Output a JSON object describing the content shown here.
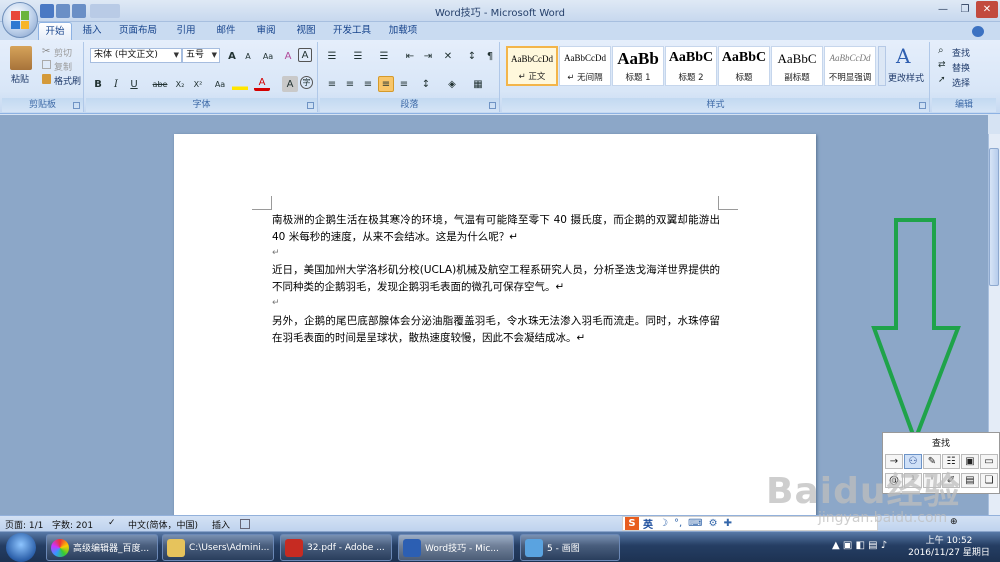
{
  "window": {
    "title": "Word技巧 - Microsoft Word",
    "title_suffix": "..."
  },
  "tabs": [
    "开始",
    "插入",
    "页面布局",
    "引用",
    "邮件",
    "审阅",
    "视图",
    "开发工具",
    "加载项"
  ],
  "clipboard": {
    "paste": "粘贴",
    "cut": "剪切",
    "copy": "复制",
    "format_painter": "格式刷",
    "group": "剪贴板"
  },
  "font": {
    "name": "宋体 (中文正文)",
    "size": "五号",
    "group": "字体",
    "bold": "B",
    "italic": "I",
    "underline": "U",
    "strike": "abe",
    "sub": "X₂",
    "sup": "X²",
    "aa": "Aa",
    "grow": "A",
    "shrink": "A",
    "clear": "A",
    "char_border": "A",
    "char_shade": "A"
  },
  "paragraph": {
    "group": "段落"
  },
  "styles": {
    "group": "样式",
    "items": [
      {
        "sample": "AaBbCcDd",
        "name": "↵ 正文"
      },
      {
        "sample": "AaBbCcDd",
        "name": "↵ 无间隔"
      },
      {
        "sample": "AaBb",
        "name": "标题 1"
      },
      {
        "sample": "AaBbC",
        "name": "标题 2"
      },
      {
        "sample": "AaBbC",
        "name": "标题"
      },
      {
        "sample": "AaBbC",
        "name": "副标题"
      },
      {
        "sample": "AaBbCcDd",
        "name": "不明显强调"
      }
    ],
    "change": "更改样式"
  },
  "editing": {
    "group": "编辑",
    "find": "查找",
    "replace": "替换",
    "select": "选择"
  },
  "document": {
    "paragraphs": [
      "南极洲的企鹅生活在极其寒冷的环境，气温有可能降至零下 40 摄氏度，而企鹅的双翼却能游出 40 米每秒的速度，从来不会结冰。这是为什么呢？↵",
      "近日，美国加州大学洛杉矶分校(UCLA)机械及航空工程系研究人员，分析圣迭戈海洋世界提供的不同种类的企鹅羽毛，发现企鹅羽毛表面的微孔可保存空气。↵",
      "另外，企鹅的尾巴底部腺体会分泌油脂覆盖羽毛，令水珠无法渗入羽毛而流走。同时，水珠停留在羽毛表面的时间是呈球状，散热速度较慢，因此不会凝结成冰。↵"
    ],
    "para_mark": "↵"
  },
  "find_panel": {
    "title": "查找"
  },
  "status": {
    "page": "页面: 1/1",
    "words": "字数: 201",
    "lang": "中文(简体，中国)",
    "insert": "插入"
  },
  "ime": {
    "lang": "英"
  },
  "taskbar": {
    "items": [
      "高级编辑器_百度...",
      "C:\\Users\\Admini...",
      "32.pdf - Adobe ...",
      "Word技巧 - Mic...",
      "5 - 画图"
    ],
    "time": "上午 10:52",
    "date": "2016/11/27 星期日"
  },
  "watermark": {
    "brand": "Baidu经验",
    "url": "jingyan.baidu.com"
  },
  "colors": {
    "arrow": "#1fa34a",
    "ribbon": "#dfe9f7",
    "accent": "#f3b54a"
  }
}
